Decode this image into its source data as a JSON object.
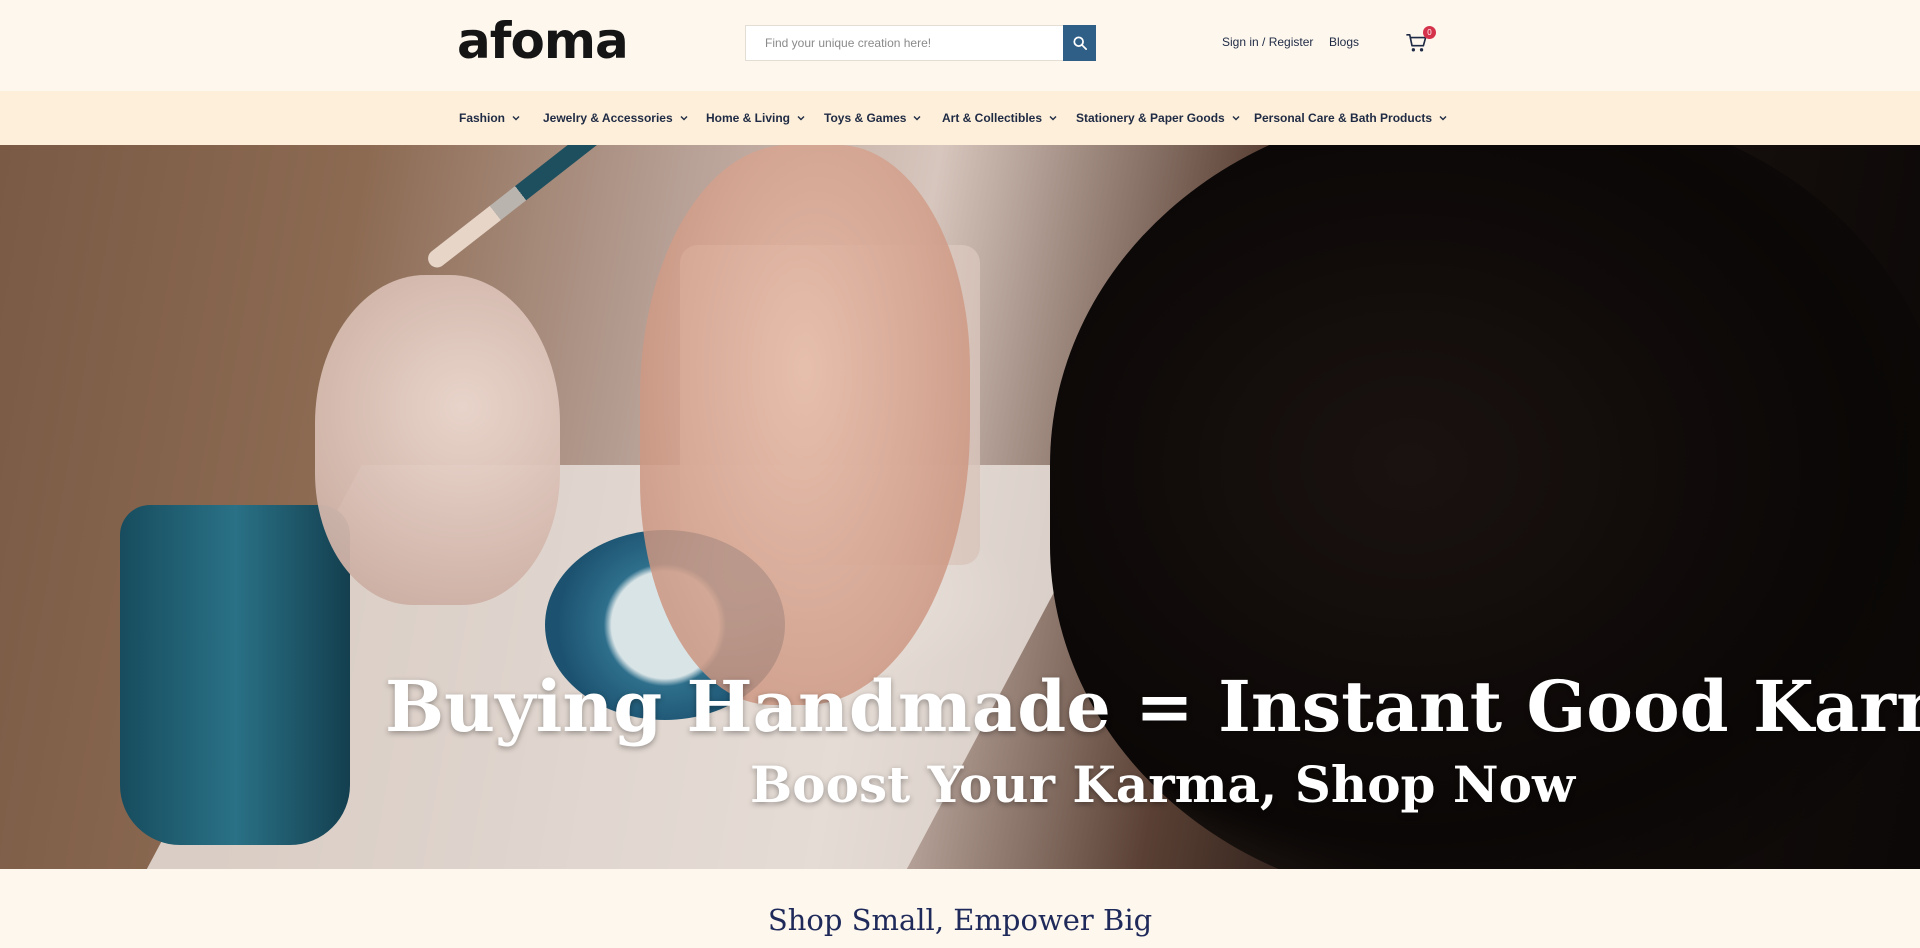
{
  "header": {
    "logo": "afoma",
    "search": {
      "placeholder": "Find your unique creation here!",
      "icon": "search-icon"
    },
    "links": {
      "signin": "Sign in / Register",
      "blogs": "Blogs"
    },
    "cart": {
      "icon": "cart-icon",
      "count": "0"
    }
  },
  "nav": {
    "items": [
      {
        "label": "Fashion"
      },
      {
        "label": "Jewelry & Accessories"
      },
      {
        "label": "Home & Living"
      },
      {
        "label": "Toys & Games"
      },
      {
        "label": "Art & Collectibles"
      },
      {
        "label": "Stationery & Paper Goods"
      },
      {
        "label": "Personal Care & Bath Products"
      }
    ]
  },
  "hero": {
    "title": "Buying Handmade = Instant Good Karma",
    "subtitle": "Boost Your Karma, Shop Now"
  },
  "section": {
    "title": "Shop Small, Empower Big"
  },
  "colors": {
    "background": "#fdf7ee",
    "nav_background": "#fdefd9",
    "search_button": "#2f5f87",
    "cart_badge": "#d5324c",
    "text_dark": "#1f2a44"
  }
}
